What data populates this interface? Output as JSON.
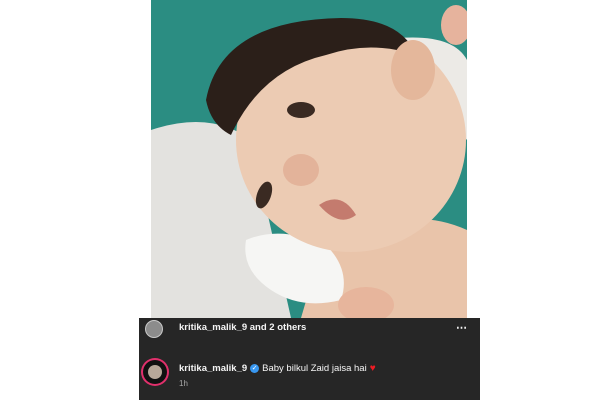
{
  "post": {
    "image_description_icon": "newborn-baby-photo"
  },
  "likes": {
    "text": "kritika_malik_9 and 2 others",
    "more_icon": "⋯"
  },
  "comment": {
    "username": "kritika_malik_9",
    "verified_icon": "✓",
    "text": "Baby bilkul Zaid jaisa hai",
    "heart_icon": "♥",
    "time": "1h"
  },
  "colors": {
    "bar_background": "#262626",
    "verified": "#3897f0",
    "heart": "#ed1c24"
  }
}
